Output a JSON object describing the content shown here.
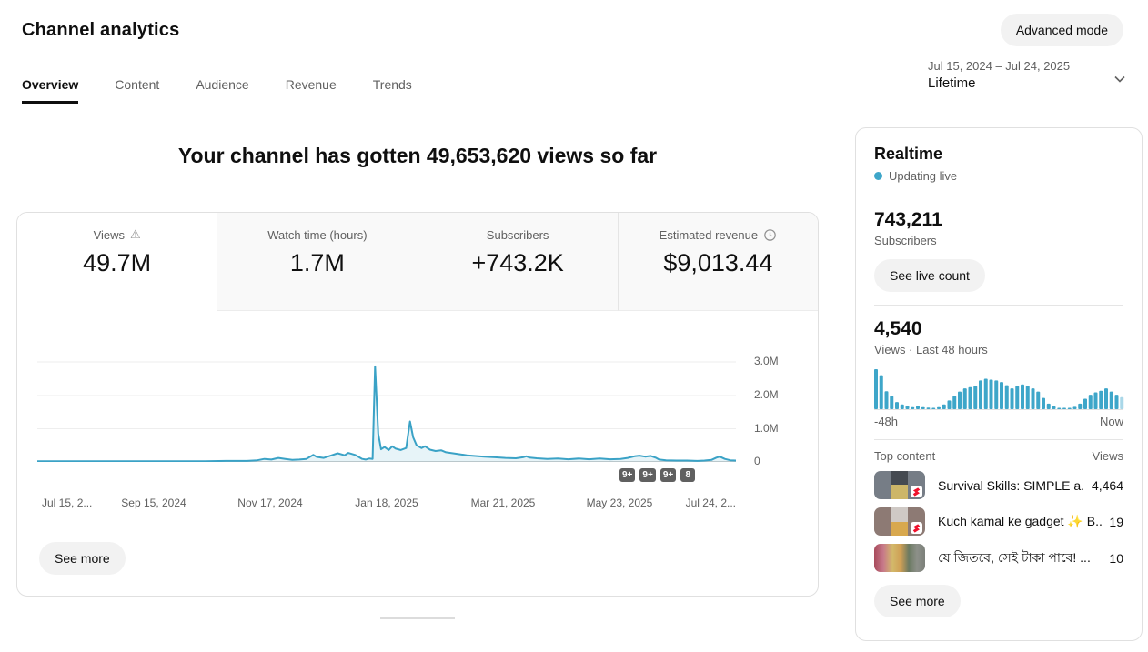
{
  "header": {
    "title": "Channel analytics",
    "advanced_mode_label": "Advanced mode",
    "date_range": "Jul 15, 2024 – Jul 24, 2025",
    "period": "Lifetime"
  },
  "tabs": [
    {
      "label": "Overview",
      "active": true
    },
    {
      "label": "Content",
      "active": false
    },
    {
      "label": "Audience",
      "active": false
    },
    {
      "label": "Revenue",
      "active": false
    },
    {
      "label": "Trends",
      "active": false
    }
  ],
  "headline": "Your channel has gotten 49,653,620 views so far",
  "metrics": [
    {
      "label": "Views",
      "value": "49.7M",
      "icon": "warning-icon",
      "active": true
    },
    {
      "label": "Watch time (hours)",
      "value": "1.7M",
      "icon": null,
      "active": false
    },
    {
      "label": "Subscribers",
      "value": "+743.2K",
      "icon": null,
      "active": false
    },
    {
      "label": "Estimated revenue",
      "value": "$9,013.44",
      "icon": "clock-icon",
      "active": false
    }
  ],
  "overflow_badges": [
    "9+",
    "9+",
    "9+",
    "8"
  ],
  "see_more_label": "See more",
  "chart_data": [
    {
      "type": "area",
      "title": "Channel views over time",
      "x_ticks": [
        "Jul 15, 2...",
        "Sep 15, 2024",
        "Nov 17, 2024",
        "Jan 18, 2025",
        "Mar 21, 2025",
        "May 23, 2025",
        "Jul 24, 2..."
      ],
      "y_tick_labels": [
        "3.0M",
        "2.0M",
        "1.0M",
        "0"
      ],
      "ylabel": "Views",
      "ylim_millions": [
        0,
        3.48
      ],
      "grid": true,
      "peak_note": "spike ~2.9M views near Jan 18, 2025; secondary spike ~1.2M",
      "points_frac_millions": [
        [
          0,
          0.02
        ],
        [
          0.04,
          0.02
        ],
        [
          0.08,
          0.02
        ],
        [
          0.12,
          0.02
        ],
        [
          0.16,
          0.02
        ],
        [
          0.2,
          0.02
        ],
        [
          0.24,
          0.02
        ],
        [
          0.27,
          0.03
        ],
        [
          0.3,
          0.03
        ],
        [
          0.315,
          0.05
        ],
        [
          0.325,
          0.09
        ],
        [
          0.335,
          0.07
        ],
        [
          0.345,
          0.12
        ],
        [
          0.355,
          0.09
        ],
        [
          0.365,
          0.06
        ],
        [
          0.375,
          0.07
        ],
        [
          0.385,
          0.09
        ],
        [
          0.395,
          0.21
        ],
        [
          0.4,
          0.15
        ],
        [
          0.41,
          0.12
        ],
        [
          0.42,
          0.19
        ],
        [
          0.43,
          0.26
        ],
        [
          0.44,
          0.2
        ],
        [
          0.445,
          0.27
        ],
        [
          0.455,
          0.21
        ],
        [
          0.465,
          0.09
        ],
        [
          0.47,
          0.07
        ],
        [
          0.475,
          0.1
        ],
        [
          0.48,
          0.09
        ],
        [
          0.4835,
          2.88
        ],
        [
          0.488,
          0.85
        ],
        [
          0.492,
          0.38
        ],
        [
          0.497,
          0.45
        ],
        [
          0.503,
          0.36
        ],
        [
          0.508,
          0.47
        ],
        [
          0.513,
          0.4
        ],
        [
          0.52,
          0.36
        ],
        [
          0.528,
          0.42
        ],
        [
          0.5335,
          1.22
        ],
        [
          0.538,
          0.74
        ],
        [
          0.543,
          0.5
        ],
        [
          0.55,
          0.42
        ],
        [
          0.555,
          0.47
        ],
        [
          0.562,
          0.37
        ],
        [
          0.57,
          0.33
        ],
        [
          0.578,
          0.35
        ],
        [
          0.585,
          0.29
        ],
        [
          0.595,
          0.26
        ],
        [
          0.605,
          0.23
        ],
        [
          0.615,
          0.2
        ],
        [
          0.625,
          0.18
        ],
        [
          0.64,
          0.16
        ],
        [
          0.655,
          0.14
        ],
        [
          0.67,
          0.12
        ],
        [
          0.685,
          0.11
        ],
        [
          0.695,
          0.14
        ],
        [
          0.7,
          0.17
        ],
        [
          0.705,
          0.13
        ],
        [
          0.715,
          0.11
        ],
        [
          0.73,
          0.09
        ],
        [
          0.745,
          0.1
        ],
        [
          0.76,
          0.08
        ],
        [
          0.775,
          0.1
        ],
        [
          0.79,
          0.08
        ],
        [
          0.805,
          0.1
        ],
        [
          0.82,
          0.08
        ],
        [
          0.835,
          0.09
        ],
        [
          0.845,
          0.12
        ],
        [
          0.855,
          0.17
        ],
        [
          0.862,
          0.19
        ],
        [
          0.87,
          0.16
        ],
        [
          0.878,
          0.18
        ],
        [
          0.885,
          0.13
        ],
        [
          0.89,
          0.07
        ],
        [
          0.9,
          0.05
        ],
        [
          0.915,
          0.04
        ],
        [
          0.93,
          0.04
        ],
        [
          0.945,
          0.03
        ],
        [
          0.955,
          0.04
        ],
        [
          0.965,
          0.06
        ],
        [
          0.972,
          0.13
        ],
        [
          0.977,
          0.16
        ],
        [
          0.984,
          0.09
        ],
        [
          0.992,
          0.05
        ],
        [
          1,
          0.04
        ]
      ]
    },
    {
      "type": "bar",
      "title": "Views · Last 48 hours",
      "total_views": "4,540",
      "x_range_labels": [
        "-48h",
        "Now"
      ],
      "values_norm": [
        1.0,
        0.85,
        0.45,
        0.33,
        0.18,
        0.12,
        0.08,
        0.05,
        0.08,
        0.05,
        0.04,
        0.03,
        0.05,
        0.12,
        0.22,
        0.33,
        0.44,
        0.52,
        0.55,
        0.58,
        0.72,
        0.76,
        0.74,
        0.72,
        0.68,
        0.6,
        0.52,
        0.58,
        0.62,
        0.58,
        0.52,
        0.44,
        0.28,
        0.14,
        0.07,
        0.03,
        0.02,
        0.03,
        0.06,
        0.14,
        0.26,
        0.36,
        0.42,
        0.46,
        0.52,
        0.44,
        0.36,
        0.3
      ]
    }
  ],
  "realtime": {
    "title": "Realtime",
    "status": "Updating live",
    "subscribers": "743,211",
    "subscribers_label": "Subscribers",
    "live_count_label": "See live count",
    "views_48h": "4,540",
    "views_48h_label": "Views · Last 48 hours",
    "axis_left": "-48h",
    "axis_right": "Now",
    "top_content_label": "Top content",
    "views_col_label": "Views",
    "items": [
      {
        "title": "Survival Skills: SIMPLE a...",
        "views": "4,464",
        "shorts_badge": true
      },
      {
        "title": "Kuch kamal ke gadget ✨ B...",
        "views": "19",
        "shorts_badge": true
      },
      {
        "title": "যে জিতবে, সেই টাকা পাবে! ...",
        "views": "10",
        "shorts_badge": false
      }
    ],
    "see_more_label": "See more"
  },
  "colors": {
    "accent_line": "#3aa2c6",
    "accent_fill": "rgba(58,162,198,0.12)",
    "bar_color": "#3ea6c9",
    "bar_last_color": "#a9d7e8",
    "badge_bg": "#606060",
    "live_dot": "#3ea6c9",
    "gridline": "#eeeeee",
    "baseline": "#cccccc"
  }
}
